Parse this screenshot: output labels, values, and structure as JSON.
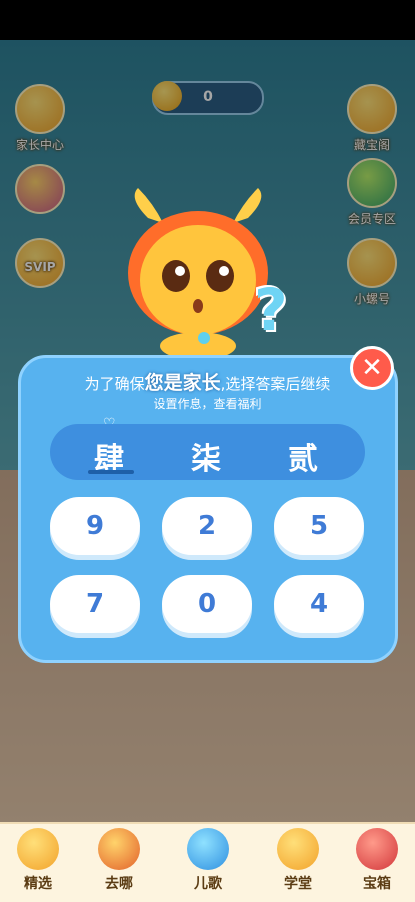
{
  "currency": {
    "count": "0"
  },
  "side_left": [
    {
      "label": "家长中心",
      "icon": "parent-center-icon"
    },
    {
      "label": "",
      "icon": "umbrella-icon"
    },
    {
      "label": "SVIP",
      "icon": "svip-badge-icon"
    }
  ],
  "side_right": [
    {
      "label": "藏宝阁",
      "icon": "treasure-shell-icon"
    },
    {
      "label": "会员专区",
      "icon": "member-globe-icon"
    },
    {
      "label": "小螺号",
      "icon": "conch-icon"
    }
  ],
  "dialog": {
    "title_prefix": "为了确保",
    "title_emphasis": "您是家长",
    "title_suffix": ",选择答案后继续",
    "subtitle": "设置作息，查看福利",
    "answer_chars": [
      "肆",
      "柒",
      "贰"
    ],
    "keys": [
      "9",
      "2",
      "5",
      "7",
      "0",
      "4"
    ]
  },
  "tabs": [
    {
      "label": "精选",
      "icon": "featured-icon"
    },
    {
      "label": "去哪",
      "icon": "where-mushroom-icon"
    },
    {
      "label": "儿歌",
      "icon": "music-note-icon"
    },
    {
      "label": "学堂",
      "icon": "school-icon"
    },
    {
      "label": "宝箱",
      "icon": "treasure-box-icon"
    }
  ],
  "colors": {
    "accent": "#57b2ef",
    "key_text": "#3f7bd6",
    "close": "#ff5b4b"
  }
}
